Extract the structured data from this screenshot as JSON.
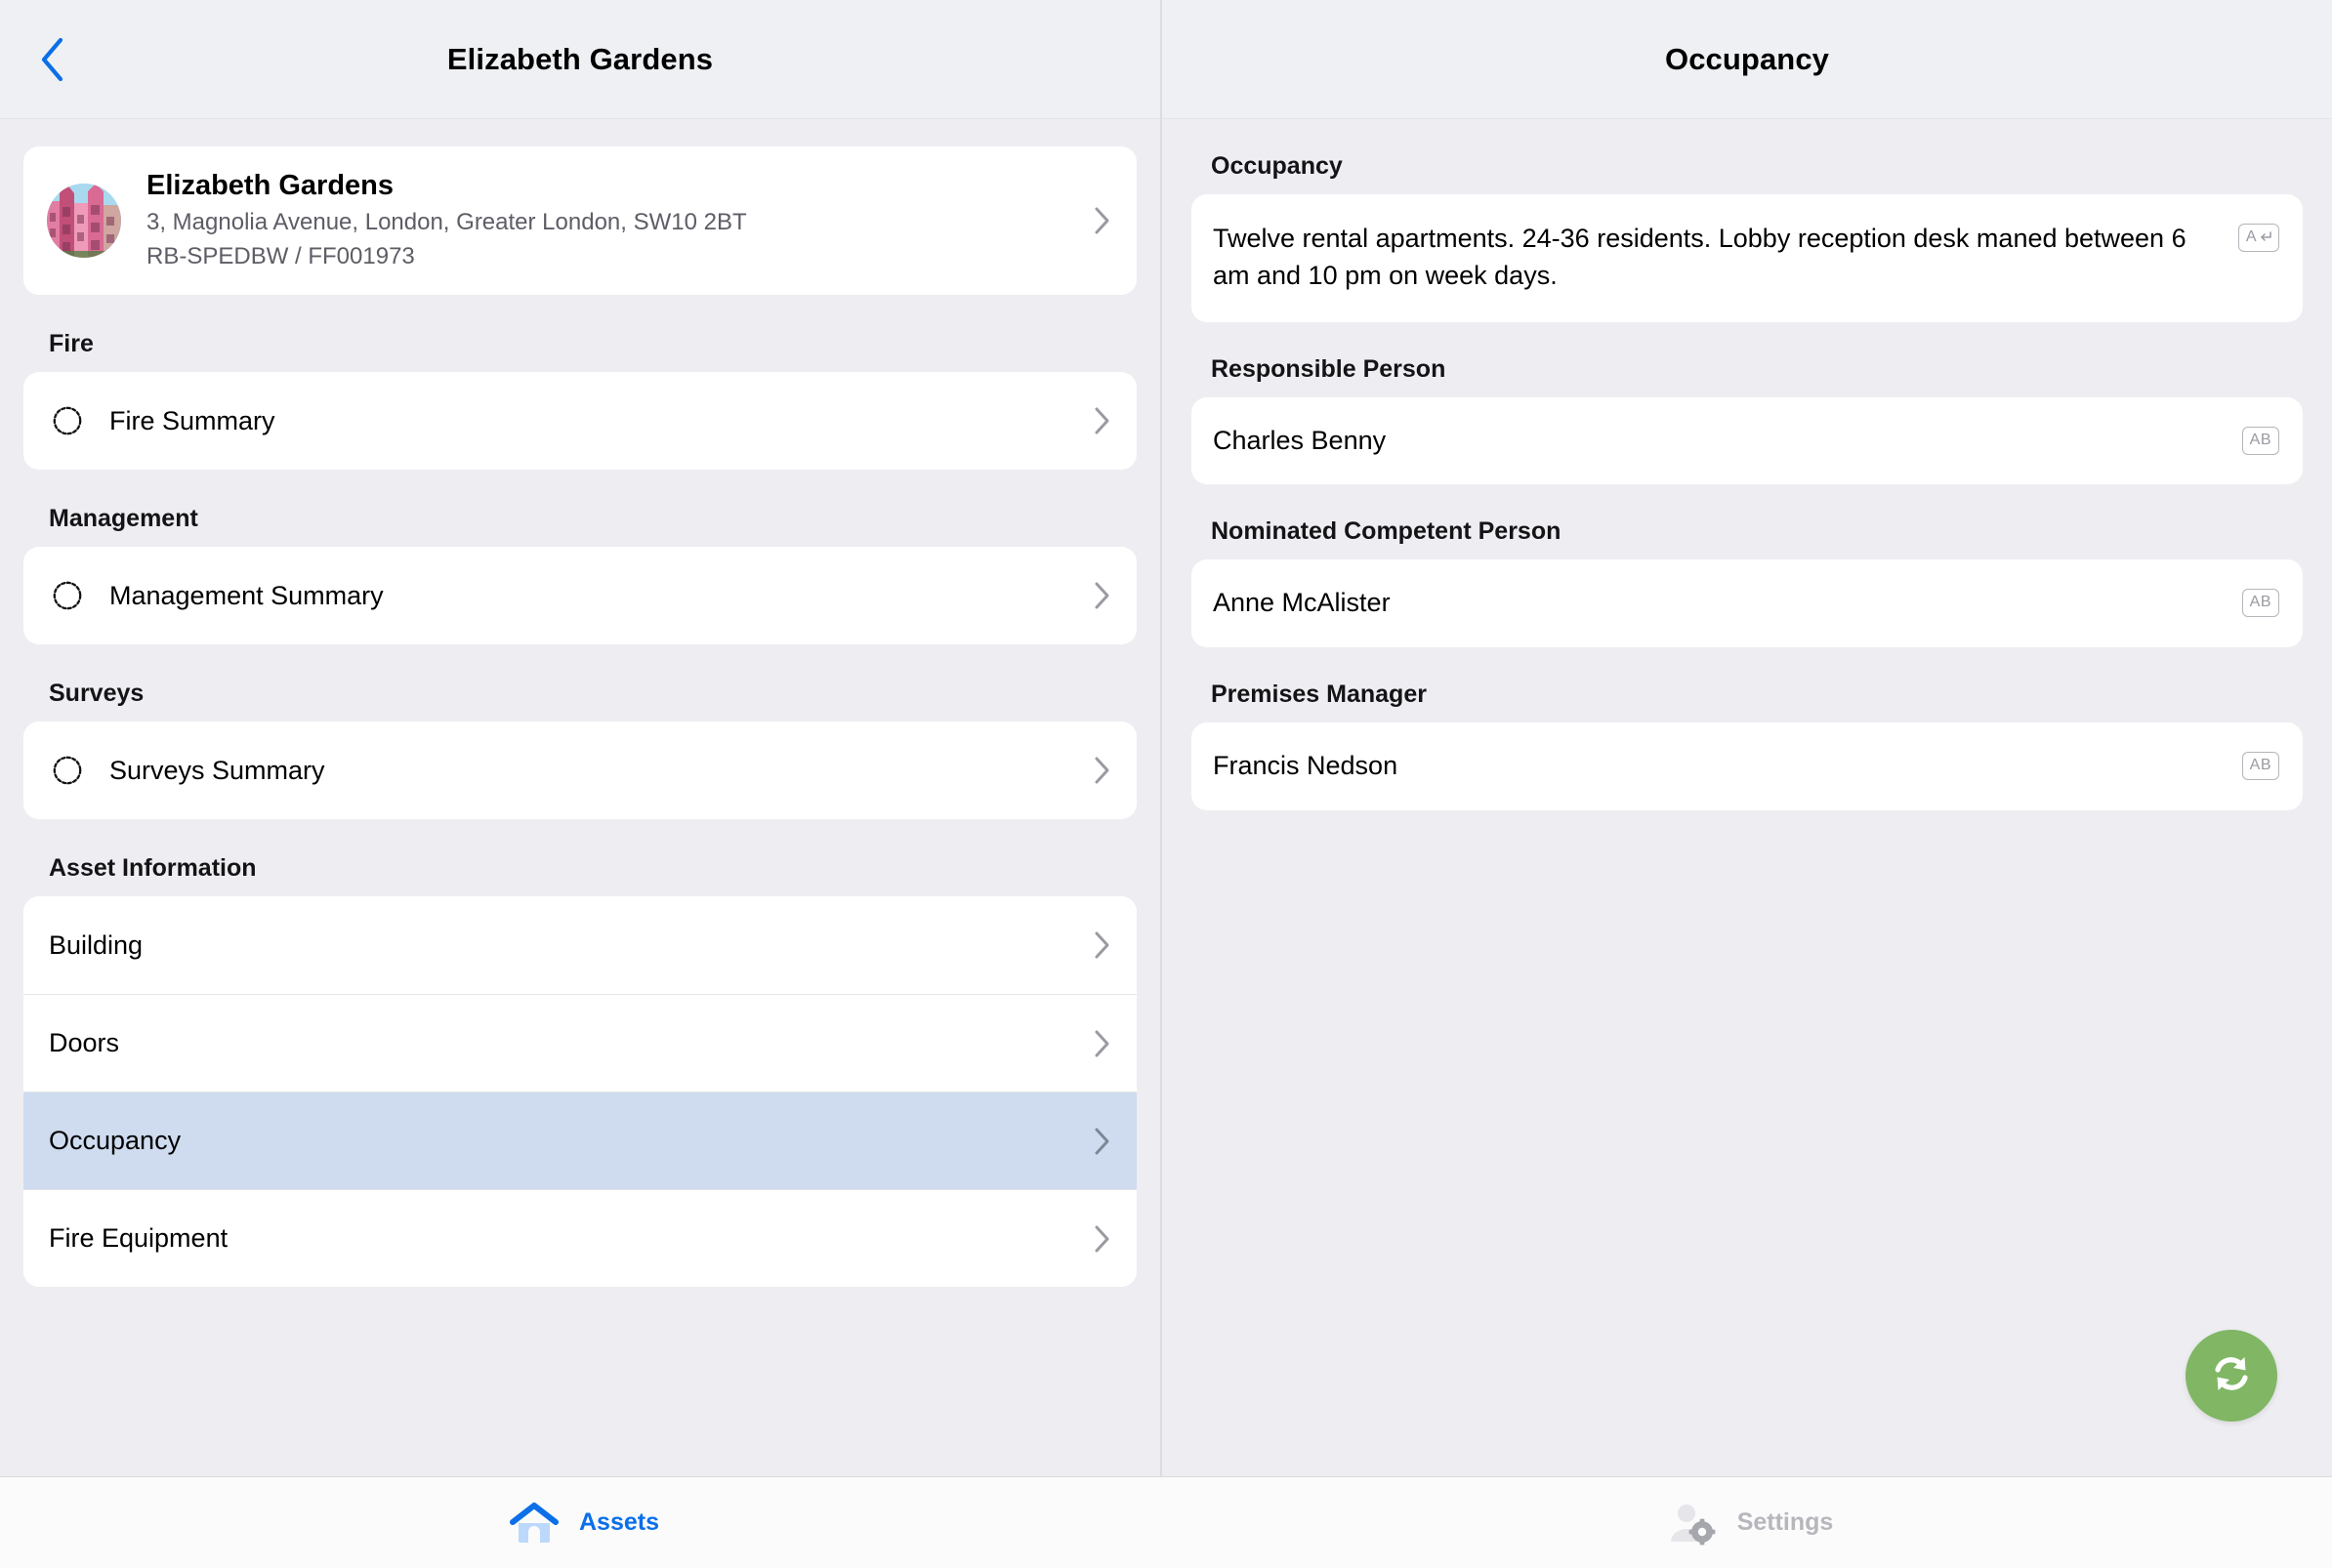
{
  "left": {
    "nav": {
      "title": "Elizabeth Gardens",
      "back_icon": "chevron-left-icon"
    },
    "asset": {
      "name": "Elizabeth Gardens",
      "address": "3, Magnolia Avenue, London, Greater London, SW10 2BT",
      "reference": "RB-SPEDBW / FF001973",
      "thumbnail_icon": "building-photo-thumbnail"
    },
    "sections": [
      {
        "heading": "Fire",
        "rows": [
          {
            "label": "Fire Summary",
            "icon": "scalloped-circle-icon",
            "selected": false,
            "has_icon": true
          }
        ]
      },
      {
        "heading": "Management",
        "rows": [
          {
            "label": "Management Summary",
            "icon": "scalloped-circle-icon",
            "selected": false,
            "has_icon": true
          }
        ]
      },
      {
        "heading": "Surveys",
        "rows": [
          {
            "label": "Surveys Summary",
            "icon": "scalloped-circle-icon",
            "selected": false,
            "has_icon": true
          }
        ]
      },
      {
        "heading": "Asset Information",
        "rows": [
          {
            "label": "Building",
            "icon": "",
            "selected": false,
            "has_icon": false
          },
          {
            "label": "Doors",
            "icon": "",
            "selected": false,
            "has_icon": false
          },
          {
            "label": "Occupancy",
            "icon": "",
            "selected": true,
            "has_icon": false
          },
          {
            "label": "Fire Equipment",
            "icon": "",
            "selected": false,
            "has_icon": false
          }
        ]
      }
    ]
  },
  "right": {
    "nav": {
      "title": "Occupancy"
    },
    "fields": [
      {
        "label": "Occupancy",
        "value": "Twelve rental apartments. 24-36 residents. Lobby reception desk maned between 6 am and 10 pm on week days.",
        "badge": "A",
        "badge_type": "multiline-text-badge",
        "multiline": true
      },
      {
        "label": "Responsible Person",
        "value": "Charles Benny",
        "badge": "AB",
        "badge_type": "text-badge",
        "multiline": false
      },
      {
        "label": "Nominated Competent Person",
        "value": "Anne McAlister",
        "badge": "AB",
        "badge_type": "text-badge",
        "multiline": false
      },
      {
        "label": "Premises Manager",
        "value": "Francis Nedson",
        "badge": "AB",
        "badge_type": "text-badge",
        "multiline": false
      }
    ],
    "sync_button": {
      "icon": "refresh-sync-icon",
      "color": "#80b664"
    }
  },
  "tab_bar": {
    "tabs": [
      {
        "label": "Assets",
        "icon": "home-icon",
        "active": true
      },
      {
        "label": "Settings",
        "icon": "user-gear-icon",
        "active": false
      }
    ],
    "active_color": "#0b6fe8",
    "inactive_color": "#b6b6bc"
  },
  "colors": {
    "page_background": "#eeeef2",
    "card_background": "#ffffff",
    "selected_row": "#cfdcef",
    "accent_blue": "#0b6fe8",
    "sync_green": "#80b664"
  }
}
